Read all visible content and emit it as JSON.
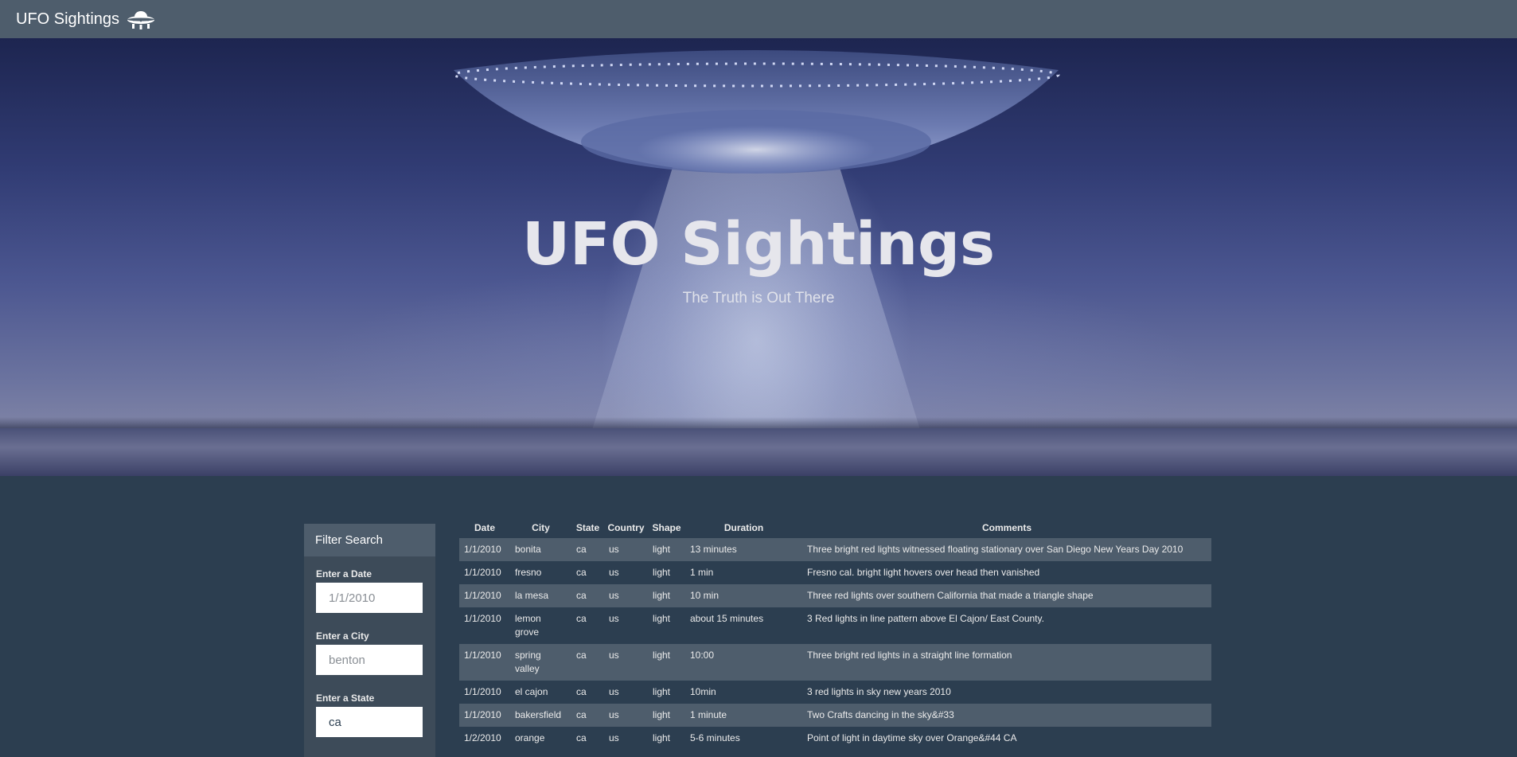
{
  "navbar": {
    "brand_label": "UFO Sightings",
    "brand_icon": "ufo-icon"
  },
  "hero": {
    "title": "UFO Sightings",
    "subtitle": "The Truth is Out There"
  },
  "filter": {
    "header": "Filter Search",
    "fields": [
      {
        "label": "Enter a Date",
        "placeholder": "1/1/2010",
        "value": ""
      },
      {
        "label": "Enter a City",
        "placeholder": "benton",
        "value": ""
      },
      {
        "label": "Enter a State",
        "placeholder": "",
        "value": "ca"
      }
    ]
  },
  "table": {
    "headers": [
      "Date",
      "City",
      "State",
      "Country",
      "Shape",
      "Duration",
      "Comments"
    ],
    "rows": [
      [
        "1/1/2010",
        "bonita",
        "ca",
        "us",
        "light",
        "13 minutes",
        "Three bright red lights witnessed floating stationary over San Diego New Years Day 2010"
      ],
      [
        "1/1/2010",
        "fresno",
        "ca",
        "us",
        "light",
        "1 min",
        "Fresno cal. bright light hovers over head then vanished"
      ],
      [
        "1/1/2010",
        "la mesa",
        "ca",
        "us",
        "light",
        "10 min",
        "Three red lights over southern California that made a triangle shape"
      ],
      [
        "1/1/2010",
        "lemon grove",
        "ca",
        "us",
        "light",
        "about 15 minutes",
        "3 Red lights in line pattern above El Cajon/ East County."
      ],
      [
        "1/1/2010",
        "spring valley",
        "ca",
        "us",
        "light",
        "10:00",
        "Three bright red lights in a straight line formation"
      ],
      [
        "1/1/2010",
        "el cajon",
        "ca",
        "us",
        "light",
        "10min",
        "3 red lights in sky new years 2010"
      ],
      [
        "1/1/2010",
        "bakersfield",
        "ca",
        "us",
        "light",
        "1 minute",
        "Two Crafts dancing in the sky&#33"
      ],
      [
        "1/2/2010",
        "orange",
        "ca",
        "us",
        "light",
        "5-6 minutes",
        "Point of light in daytime sky over Orange&#44 CA"
      ]
    ]
  },
  "colors": {
    "page_bg": "#2c3e50",
    "navbar_bg": "#4e5d6c",
    "striped_row": "#4e5d6c"
  }
}
